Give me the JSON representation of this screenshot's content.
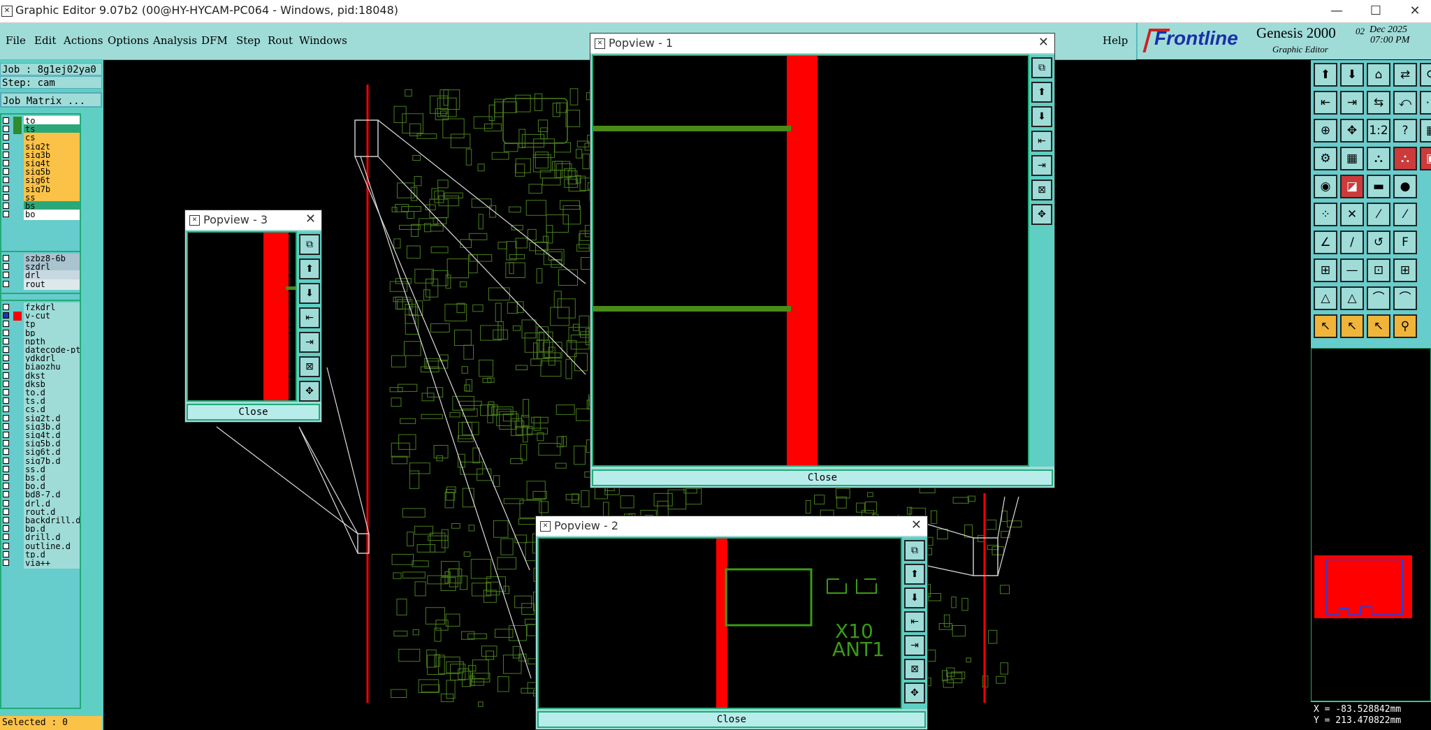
{
  "window": {
    "title": "Graphic Editor 9.07b2 (00@HY-HYCAM-PC064 - Windows, pid:18048)",
    "app_icon": "graphic-editor-icon",
    "minimize": "—",
    "maximize": "☐",
    "close": "✕"
  },
  "menu": {
    "items": [
      "File",
      "Edit",
      "Actions",
      "Options",
      "Analysis",
      "DFM",
      "Step",
      "Rout",
      "Windows"
    ],
    "help": "Help"
  },
  "brand": {
    "logo": "Frontline",
    "product": "Genesis 2000",
    "subtitle": "Graphic Editor",
    "date_day": "02",
    "date_month_year": "Dec 2025",
    "time": "07:00 PM"
  },
  "job": {
    "job_label": "Job : 8g1ej02ya0",
    "step_label": "Step: cam",
    "matrix_button": "Job Matrix ..."
  },
  "layers_board": [
    {
      "name": "to",
      "color": "#2e8b2e",
      "bg": "#ffffff"
    },
    {
      "name": "ts",
      "color": "#2e8b2e",
      "bg": "#2aa87a"
    },
    {
      "name": "cs",
      "color": "",
      "bg": "#fbc248"
    },
    {
      "name": "sig2t",
      "color": "",
      "bg": "#fbc248"
    },
    {
      "name": "sig3b",
      "color": "",
      "bg": "#fbc248"
    },
    {
      "name": "sig4t",
      "color": "",
      "bg": "#fbc248"
    },
    {
      "name": "sig5b",
      "color": "",
      "bg": "#fbc248"
    },
    {
      "name": "sig6t",
      "color": "",
      "bg": "#fbc248"
    },
    {
      "name": "sig7b",
      "color": "",
      "bg": "#fbc248"
    },
    {
      "name": "ss",
      "color": "",
      "bg": "#fbc248"
    },
    {
      "name": "bs",
      "color": "",
      "bg": "#2aa87a"
    },
    {
      "name": "bo",
      "color": "",
      "bg": "#ffffff"
    }
  ],
  "layers_drill": [
    {
      "name": "szbz8-6b",
      "bg": "#a9c3cf"
    },
    {
      "name": "szdrl",
      "bg": "#a9c3cf"
    },
    {
      "name": "drl",
      "bg": "#c8d8e0"
    },
    {
      "name": "rout",
      "bg": "#dde8ec"
    }
  ],
  "layers_misc": [
    {
      "name": "fzkdrl",
      "color": "",
      "bg": "#9fdcd8",
      "check": "#ffffff"
    },
    {
      "name": "v-cut",
      "color": "#ff0000",
      "bg": "#9fdcd8",
      "check": "#2233aa"
    },
    {
      "name": "tp",
      "color": "",
      "bg": "#9fdcd8",
      "check": "#ffffff"
    },
    {
      "name": "bp",
      "color": "",
      "bg": "#9fdcd8",
      "check": "#ffffff"
    },
    {
      "name": "npth",
      "color": "",
      "bg": "#9fdcd8",
      "check": "#ffffff"
    },
    {
      "name": "datecode-ptc",
      "color": "",
      "bg": "#9fdcd8",
      "check": "#ffffff"
    },
    {
      "name": "ydkdrl",
      "color": "",
      "bg": "#9fdcd8",
      "check": "#ffffff"
    },
    {
      "name": "biaozhu",
      "color": "",
      "bg": "#9fdcd8",
      "check": "#ffffff"
    },
    {
      "name": "dkst",
      "color": "",
      "bg": "#9fdcd8",
      "check": "#ffffff"
    },
    {
      "name": "dksb",
      "color": "",
      "bg": "#9fdcd8",
      "check": "#ffffff"
    },
    {
      "name": "to.d",
      "color": "",
      "bg": "#9fdcd8",
      "check": "#ffffff"
    },
    {
      "name": "ts.d",
      "color": "",
      "bg": "#9fdcd8",
      "check": "#ffffff"
    },
    {
      "name": "cs.d",
      "color": "",
      "bg": "#9fdcd8",
      "check": "#ffffff"
    },
    {
      "name": "sig2t.d",
      "color": "",
      "bg": "#9fdcd8",
      "check": "#ffffff"
    },
    {
      "name": "sig3b.d",
      "color": "",
      "bg": "#9fdcd8",
      "check": "#ffffff"
    },
    {
      "name": "sig4t.d",
      "color": "",
      "bg": "#9fdcd8",
      "check": "#ffffff"
    },
    {
      "name": "sig5b.d",
      "color": "",
      "bg": "#9fdcd8",
      "check": "#ffffff"
    },
    {
      "name": "sig6t.d",
      "color": "",
      "bg": "#9fdcd8",
      "check": "#ffffff"
    },
    {
      "name": "sig7b.d",
      "color": "",
      "bg": "#9fdcd8",
      "check": "#ffffff"
    },
    {
      "name": "ss.d",
      "color": "",
      "bg": "#9fdcd8",
      "check": "#ffffff"
    },
    {
      "name": "bs.d",
      "color": "",
      "bg": "#9fdcd8",
      "check": "#ffffff"
    },
    {
      "name": "bo.d",
      "color": "",
      "bg": "#9fdcd8",
      "check": "#ffffff"
    },
    {
      "name": "bd8-7.d",
      "color": "",
      "bg": "#9fdcd8",
      "check": "#ffffff"
    },
    {
      "name": "drl.d",
      "color": "",
      "bg": "#9fdcd8",
      "check": "#ffffff"
    },
    {
      "name": "rout.d",
      "color": "",
      "bg": "#9fdcd8",
      "check": "#ffffff"
    },
    {
      "name": "backdrill.d",
      "color": "",
      "bg": "#9fdcd8",
      "check": "#ffffff"
    },
    {
      "name": "bp.d",
      "color": "",
      "bg": "#9fdcd8",
      "check": "#ffffff"
    },
    {
      "name": "drill.d",
      "color": "",
      "bg": "#9fdcd8",
      "check": "#ffffff"
    },
    {
      "name": "outline.d",
      "color": "",
      "bg": "#9fdcd8",
      "check": "#ffffff"
    },
    {
      "name": "tp.d",
      "color": "",
      "bg": "#9fdcd8",
      "check": "#ffffff"
    },
    {
      "name": "via++",
      "color": "",
      "bg": "#9fdcd8",
      "check": "#ffffff"
    }
  ],
  "status": {
    "selected": "Selected : 0",
    "x": "X = -83.528842mm",
    "y": "Y = 213.470822mm"
  },
  "popups": {
    "p1": {
      "title": "Popview - 1",
      "close": "Close"
    },
    "p2": {
      "title": "Popview - 2",
      "close": "Close",
      "label1": "X10",
      "label2": "ANT1"
    },
    "p3": {
      "title": "Popview - 3",
      "close": "Close"
    }
  },
  "popup_buttons": [
    "zoom-home-icon",
    "zoom-in-icon",
    "zoom-out-icon",
    "pan-left-icon",
    "pan-right-icon",
    "fit-icon",
    "move-icon"
  ],
  "toolbar_right": [
    [
      "zoom-home-icon",
      "zoom-in-icon",
      "home-icon",
      "pan-icon",
      "redraw-icon"
    ],
    [
      "zoom-left-icon",
      "zoom-right-icon",
      "zoom-fit-icon",
      "zoom-back-icon",
      "snap-icon"
    ],
    [
      "fit-icon",
      "center-icon",
      "scale-icon",
      "help-icon",
      "grid-icon"
    ],
    [
      "cross-icon",
      "grid-toggle-icon",
      "net-icon",
      "net-alt-icon",
      "layer-icon"
    ],
    [
      "pad-icon",
      "add-icon",
      "line-icon",
      "circle-icon",
      ""
    ],
    [
      "connect-icon",
      "delete-icon",
      "move-icon",
      "copy-icon",
      ""
    ],
    [
      "angle-icon",
      "slope-icon",
      "arc-icon",
      "text-icon",
      ""
    ],
    [
      "hole-icon",
      "dim-icon",
      "measure-icon",
      "array-icon",
      ""
    ],
    [
      "tri-icon",
      "poly-icon",
      "arch-icon",
      "arch-alt-icon",
      ""
    ],
    [
      "select-icon",
      "select-alt-icon",
      "pointer-icon",
      "route-icon",
      ""
    ]
  ],
  "colors": {
    "panel": "#9fdcd8",
    "panel_dark": "#5fcfc4",
    "vcut_red": "#ff0000",
    "trace_green": "#4a7f1e",
    "highlight_yellow": "#fbc248"
  }
}
